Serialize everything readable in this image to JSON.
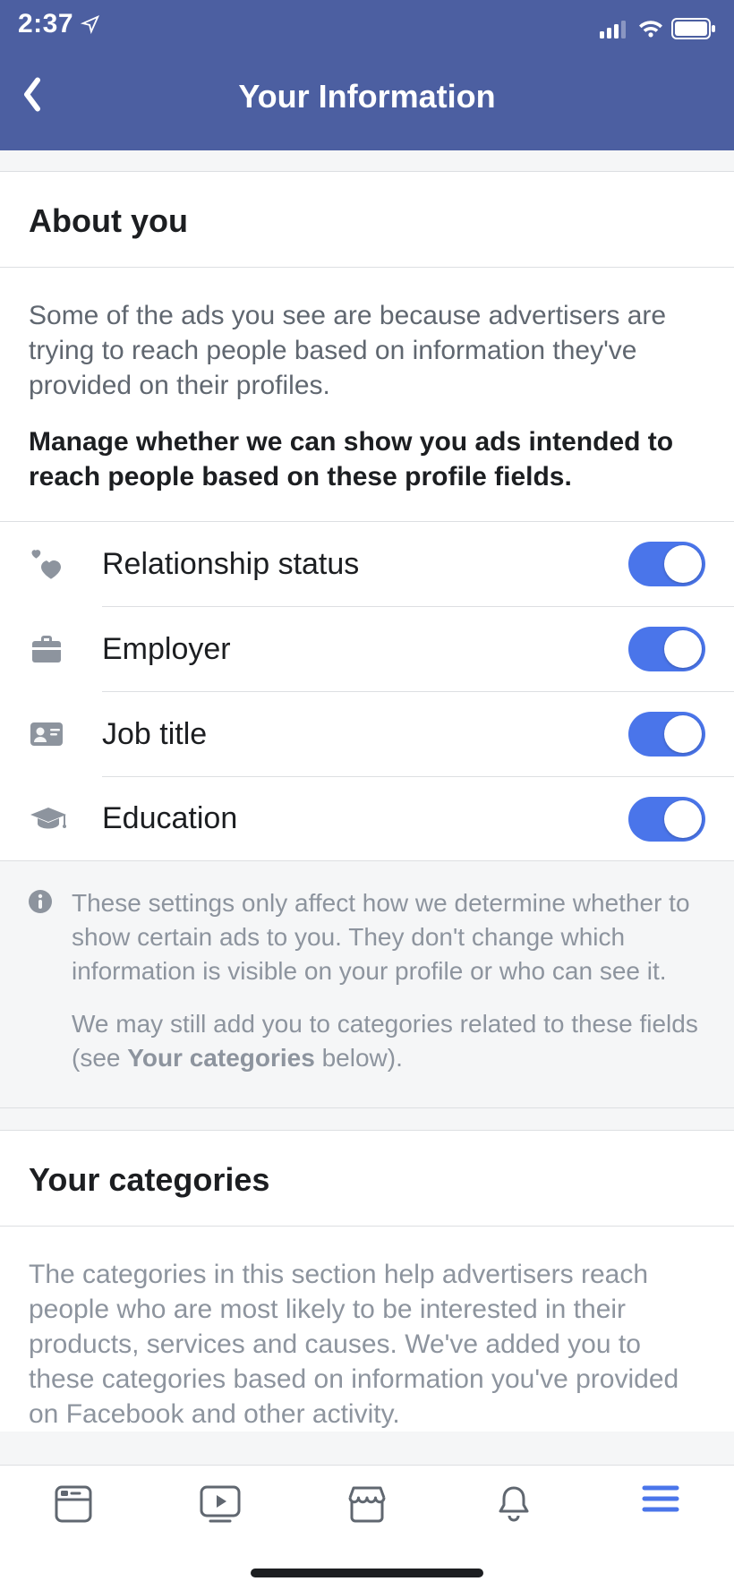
{
  "status": {
    "time": "2:37"
  },
  "nav": {
    "title": "Your Information"
  },
  "about": {
    "heading": "About you",
    "p1": "Some of the ads you see are because advertisers are trying to reach people based on information they've provided on their profiles.",
    "p2": "Manage whether we can show you ads intended to reach people based on these profile fields."
  },
  "fields": [
    {
      "label": "Relationship status",
      "on": true
    },
    {
      "label": "Employer",
      "on": true
    },
    {
      "label": "Job title",
      "on": true
    },
    {
      "label": "Education",
      "on": true
    }
  ],
  "info": {
    "p1": "These settings only affect how we determine whether to show certain ads to you. They don't change which information is visible on your profile or who can see it.",
    "p2a": "We may still add you to categories related to these fields (see ",
    "p2b": "Your categories",
    "p2c": " below)."
  },
  "categories": {
    "heading": "Your categories",
    "p1": "The categories in this section help advertisers reach people who are most likely to be interested in their products, services and causes. We've added you to these categories based on information you've provided on Facebook and other activity."
  }
}
